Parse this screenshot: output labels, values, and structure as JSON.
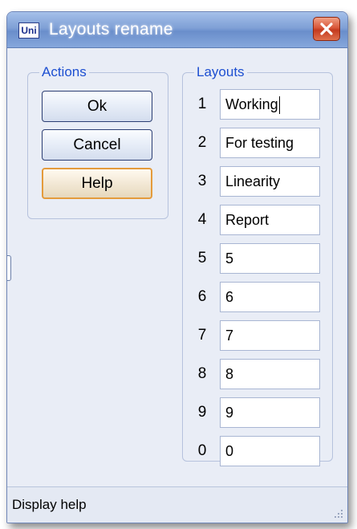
{
  "window": {
    "title": "Layouts rename",
    "app_icon_label": "Uni",
    "accent_color": "#7fa0d6",
    "close_color": "#d9573a"
  },
  "actions": {
    "legend": "Actions",
    "ok_label": "Ok",
    "cancel_label": "Cancel",
    "help_label": "Help"
  },
  "layouts": {
    "legend": "Layouts",
    "rows": [
      {
        "number": "1",
        "value": "Working"
      },
      {
        "number": "2",
        "value": "For testing"
      },
      {
        "number": "3",
        "value": "Linearity"
      },
      {
        "number": "4",
        "value": "Report"
      },
      {
        "number": "5",
        "value": "5"
      },
      {
        "number": "6",
        "value": "6"
      },
      {
        "number": "7",
        "value": "7"
      },
      {
        "number": "8",
        "value": "8"
      },
      {
        "number": "9",
        "value": "9"
      },
      {
        "number": "0",
        "value": "0"
      }
    ]
  },
  "statusbar": {
    "text": "Display help"
  },
  "icons": {
    "app": "app-icon",
    "close": "close-icon",
    "grip": "size-grip-icon"
  }
}
